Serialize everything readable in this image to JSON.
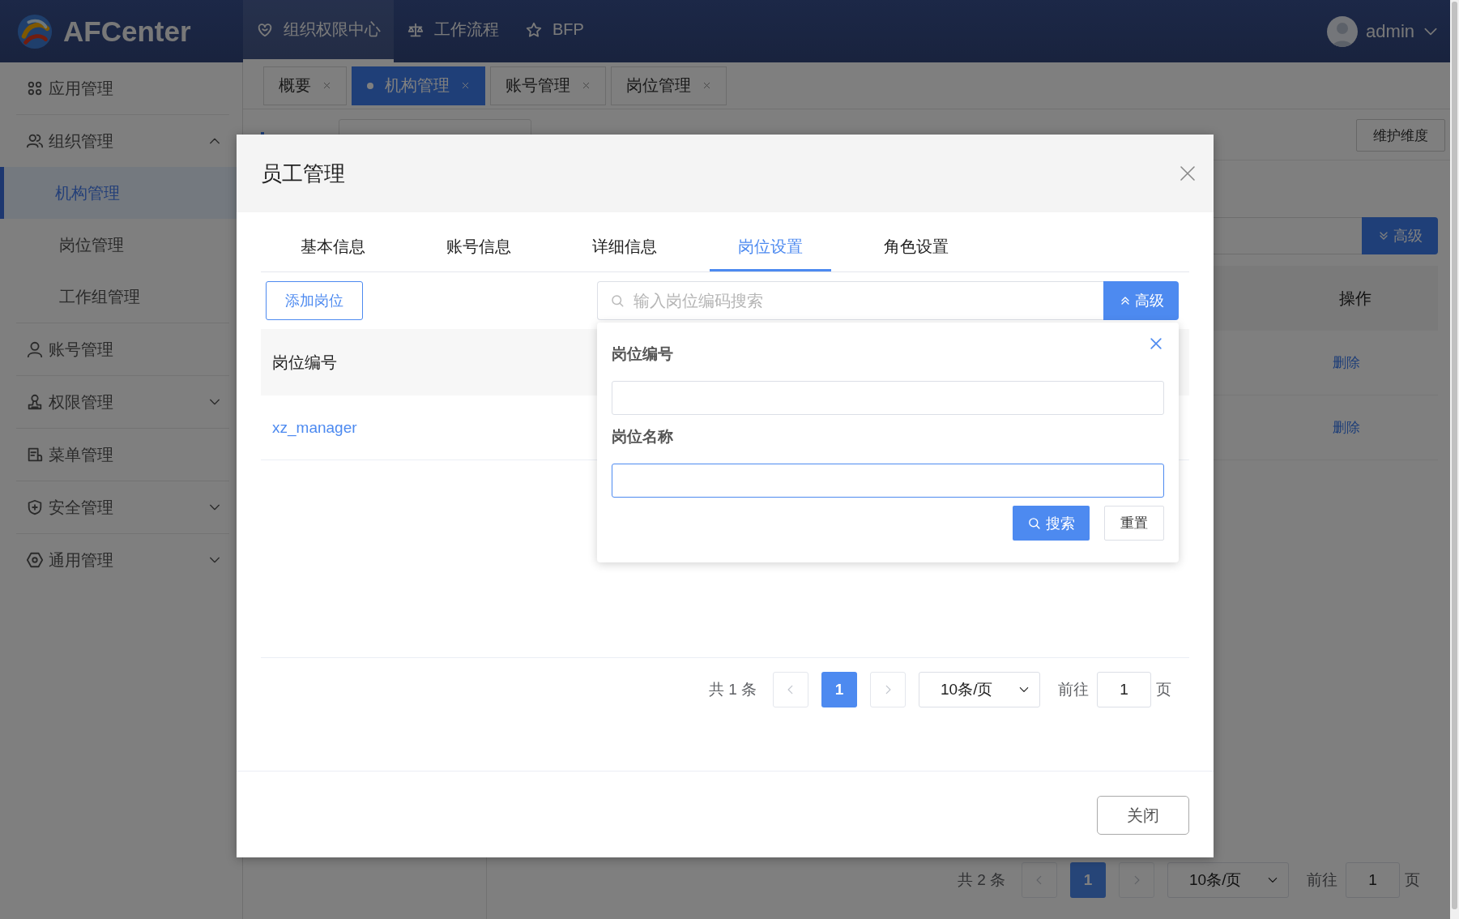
{
  "header": {
    "logo": "AFCenter",
    "nav": [
      {
        "label": "组织权限中心",
        "selected": true
      },
      {
        "label": "工作流程",
        "selected": false
      },
      {
        "label": "BFP",
        "selected": false
      }
    ],
    "user": "admin"
  },
  "sidebar": {
    "items": [
      {
        "label": "应用管理"
      },
      {
        "label": "组织管理",
        "expanded": true,
        "children": [
          {
            "label": "机构管理",
            "selected": true
          },
          {
            "label": "岗位管理",
            "selected": false
          },
          {
            "label": "工作组管理",
            "selected": false
          }
        ]
      },
      {
        "label": "账号管理"
      },
      {
        "label": "权限管理",
        "expanded": false
      },
      {
        "label": "菜单管理"
      },
      {
        "label": "安全管理",
        "expanded": false
      },
      {
        "label": "通用管理",
        "expanded": false
      }
    ]
  },
  "tabs": [
    {
      "label": "概要",
      "selected": false
    },
    {
      "label": "机构管理",
      "selected": true
    },
    {
      "label": "账号管理",
      "selected": false
    },
    {
      "label": "岗位管理",
      "selected": false
    }
  ],
  "content": {
    "maintain_button": "维护维度",
    "advanced_button": "高级",
    "table": {
      "columns": [
        "操作"
      ],
      "rows": [
        [
          "删除"
        ],
        [
          "删除"
        ]
      ]
    },
    "pagination": {
      "total": "共 2 条",
      "page": "1",
      "page_size": "10条/页",
      "goto": "前往",
      "goto_value": "1",
      "suffix": "页"
    }
  },
  "dialog": {
    "title": "员工管理",
    "tabs": [
      {
        "label": "基本信息",
        "selected": false
      },
      {
        "label": "账号信息",
        "selected": false
      },
      {
        "label": "详细信息",
        "selected": false
      },
      {
        "label": "岗位设置",
        "selected": true
      },
      {
        "label": "角色设置",
        "selected": false
      }
    ],
    "add_button": "添加岗位",
    "search": {
      "placeholder": "输入岗位编码搜索",
      "advanced_button": "高级"
    },
    "table": {
      "columns": [
        "岗位编号"
      ],
      "rows": [
        [
          "xz_manager"
        ]
      ]
    },
    "filter": {
      "fields": [
        {
          "label": "岗位编号",
          "focused": false
        },
        {
          "label": "岗位名称",
          "focused": true
        }
      ],
      "search_button": "搜索",
      "reset_button": "重置"
    },
    "pagination": {
      "total": "共 1 条",
      "page": "1",
      "page_size": "10条/页",
      "goto": "前往",
      "goto_value": "1",
      "suffix": "页"
    },
    "close_button": "关闭"
  }
}
